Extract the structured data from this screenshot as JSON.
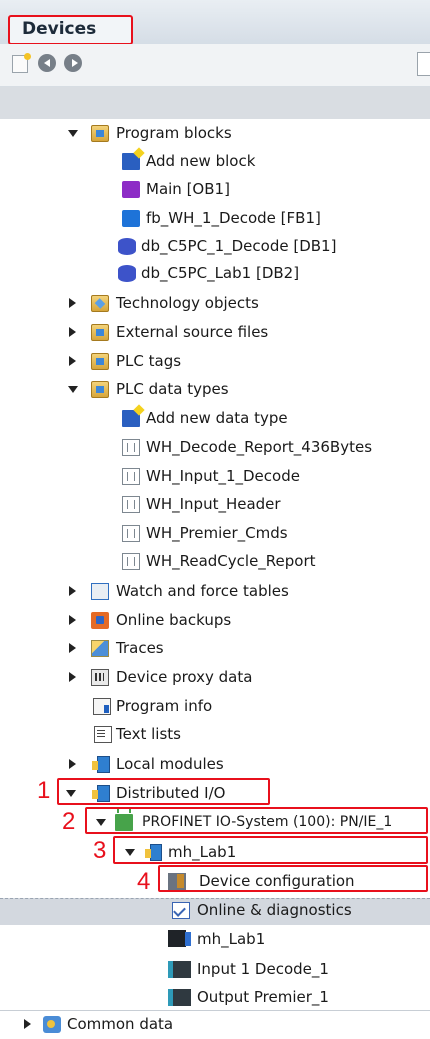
{
  "panel": {
    "title": "Devices"
  },
  "toolbar": {
    "new_icon": "new-item-icon",
    "back_icon": "back-arrow-icon",
    "forward_icon": "forward-arrow-icon"
  },
  "tree": {
    "program_blocks": "Program blocks",
    "add_new_block": "Add new block",
    "main_ob1": "Main [OB1]",
    "fb_wh_1_decode": "fb_WH_1_Decode [FB1]",
    "db_c5pc_1_decode": "db_C5PC_1_Decode [DB1]",
    "db_c5pc_lab1": "db_C5PC_Lab1 [DB2]",
    "technology_objects": "Technology objects",
    "external_source_files": "External source files",
    "plc_tags": "PLC tags",
    "plc_data_types": "PLC data types",
    "add_new_data_type": "Add new data type",
    "wh_decode_report": "WH_Decode_Report_436Bytes",
    "wh_input_1_decode": "WH_Input_1_Decode",
    "wh_input_header": "WH_Input_Header",
    "wh_premier_cmds": "WH_Premier_Cmds",
    "wh_readcycle_report": "WH_ReadCycle_Report",
    "watch_force_tables": "Watch and force tables",
    "online_backups": "Online backups",
    "traces": "Traces",
    "device_proxy_data": "Device proxy data",
    "program_info": "Program info",
    "text_lists": "Text lists",
    "local_modules": "Local modules",
    "distributed_io": "Distributed I/O",
    "profinet_system": "PROFINET IO-System (100): PN/IE_1",
    "mh_lab1": "mh_Lab1",
    "device_configuration": "Device configuration",
    "online_diagnostics": "Online & diagnostics",
    "mh_lab1_device": "mh_Lab1",
    "input_1_decode": "Input 1 Decode_1",
    "output_premier": "Output Premier_1",
    "common_data": "Common data"
  },
  "annotations": [
    "1",
    "2",
    "3",
    "4"
  ],
  "colors": {
    "highlight_red": "#e8101c",
    "selection": "#d3d8df"
  }
}
